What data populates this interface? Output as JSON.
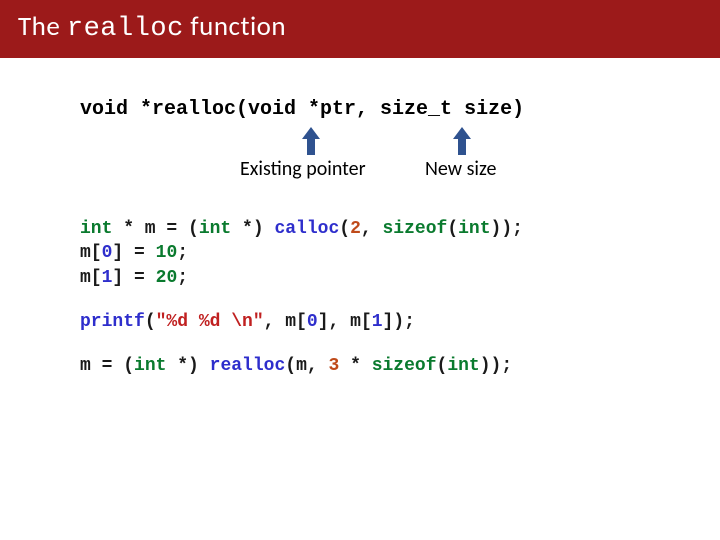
{
  "header": {
    "title_pre": "The ",
    "title_mono": "realloc",
    "title_post": " function"
  },
  "signature": {
    "text": "void *realloc(void *ptr, size_t size)"
  },
  "labels": {
    "existing_pointer": "Existing pointer",
    "new_size": "New size"
  },
  "code": {
    "l1_a": "int",
    "l1_b": " * m = (",
    "l1_c": "int",
    "l1_d": " *) ",
    "l1_e": "calloc",
    "l1_f": "(",
    "l1_g": "2",
    "l1_h": ", ",
    "l1_i": "sizeof",
    "l1_j": "(",
    "l1_k": "int",
    "l1_l": "));",
    "l2_a": "m[",
    "l2_b": "0",
    "l2_c": "] = ",
    "l2_d": "10",
    "l2_e": ";",
    "l3_a": "m[",
    "l3_b": "1",
    "l3_c": "] = ",
    "l3_d": "20",
    "l3_e": ";",
    "l4_a": "printf",
    "l4_b": "(",
    "l4_c": "\"%d %d \\n\"",
    "l4_d": ", m[",
    "l4_e": "0",
    "l4_f": "], m[",
    "l4_g": "1",
    "l4_h": "]);",
    "l5_a": "m = (",
    "l5_b": "int",
    "l5_c": " *) ",
    "l5_d": "realloc",
    "l5_e": "(m, ",
    "l5_f": "3",
    "l5_g": " * ",
    "l5_h": "sizeof",
    "l5_i": "(",
    "l5_j": "int",
    "l5_k": "));"
  }
}
